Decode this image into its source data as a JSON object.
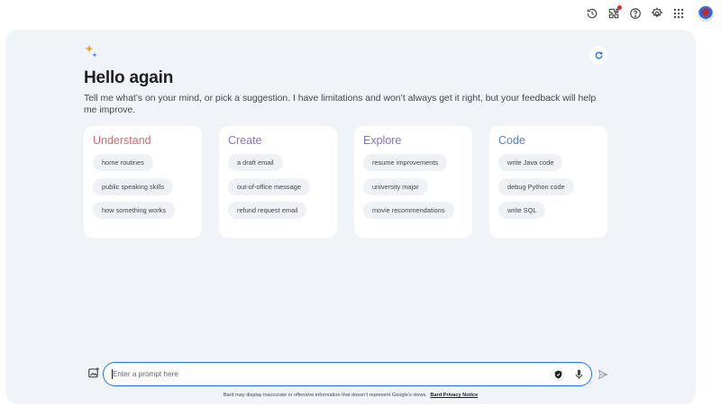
{
  "header": {
    "icons": [
      "history-icon",
      "extensions-icon",
      "help-icon",
      "settings-icon",
      "apps-grid-icon",
      "avatar"
    ]
  },
  "main": {
    "greeting": "Hello again",
    "intro": "Tell me what’s on your mind, or pick a suggestion. I have limitations and won’t always get it right, but your feedback will help me improve.",
    "cards": [
      {
        "title": "Understand",
        "color": "#d96570",
        "chips": [
          "home routines",
          "public speaking skills",
          "how something works"
        ]
      },
      {
        "title": "Create",
        "color": "#8e6ecd",
        "chips": [
          "a draft email",
          "out-of-office message",
          "refund request email"
        ]
      },
      {
        "title": "Explore",
        "color": "#7c6fd6",
        "chips": [
          "resume improvements",
          "university major",
          "movie recommendations"
        ]
      },
      {
        "title": "Code",
        "color": "#4f80d6",
        "chips": [
          "write Java code",
          "debug Python code",
          "write SQL"
        ]
      }
    ]
  },
  "prompt": {
    "placeholder": "Enter a prompt here",
    "value": ""
  },
  "footer": {
    "disclaimer": "Bard may display inaccurate or offensive information that doesn’t represent Google’s views.",
    "link": "Bard Privacy Notice"
  },
  "colors": {
    "panel_bg": "#f0f4f9",
    "accent": "#1a73e8"
  }
}
